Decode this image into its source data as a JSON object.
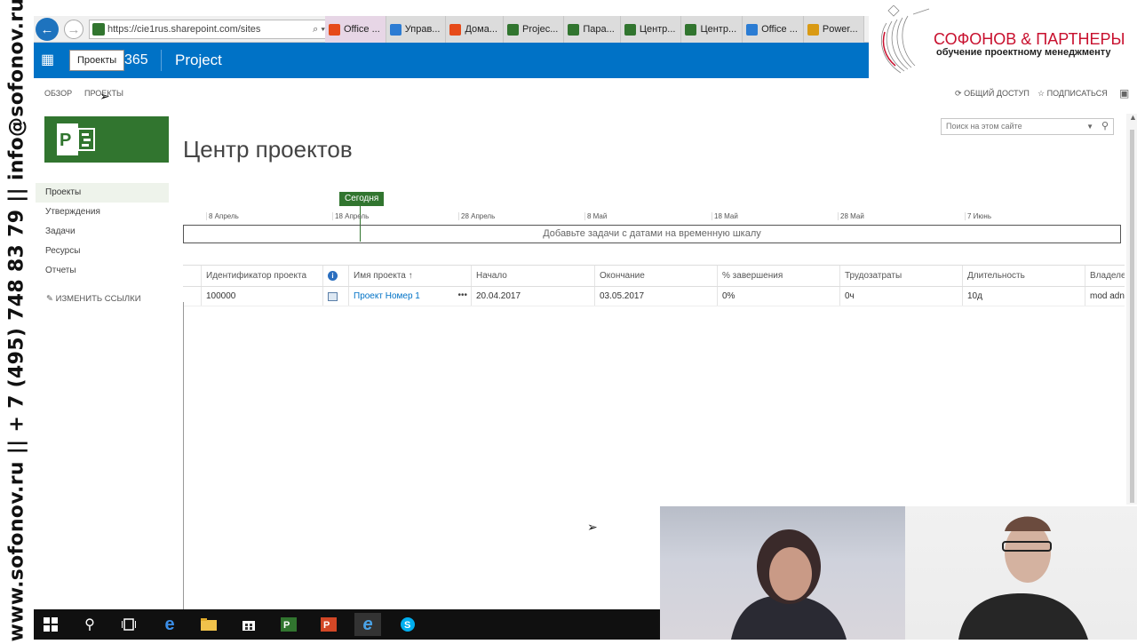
{
  "side_banner": "www.sofonov.ru || + 7 (495) 748 83 79 || info@sofonov.ru",
  "browser": {
    "url": "https://cie1rus.sharepoint.com/sites",
    "url_icons": "⌕ ▾ 🔒 ↻",
    "tabs": [
      {
        "label": "Office ...",
        "color": "#e64a19"
      },
      {
        "label": "Управ...",
        "color": "#2b7cd3"
      },
      {
        "label": "Дома...",
        "color": "#e64a19"
      },
      {
        "label": "Projec...",
        "color": "#31752f"
      },
      {
        "label": "Пара...",
        "color": "#31752f"
      },
      {
        "label": "Центр...",
        "color": "#31752f"
      },
      {
        "label": "Центр...",
        "color": "#31752f"
      },
      {
        "label": "Office ...",
        "color": "#2b7cd3"
      },
      {
        "label": "Power...",
        "color": "#d99a14"
      }
    ]
  },
  "o365": {
    "brand_partial": "365",
    "app": "Project"
  },
  "tooltip": "Проекты",
  "logo": {
    "name": "СОФОНОВ & ПАРТНЕРЫ",
    "tagline": "обучение проектному менеджменту"
  },
  "suite": {
    "tabs": [
      "ОБЗОР",
      "ПРОЕКТЫ"
    ],
    "share": "ОБЩИЙ ДОСТУП",
    "follow": "ПОДПИСАТЬСЯ"
  },
  "search_placeholder": "Поиск на этом сайте",
  "page_title": "Центр проектов",
  "left_nav": [
    "Проекты",
    "Утверждения",
    "Задачи",
    "Ресурсы",
    "Отчеты"
  ],
  "edit_links": "ИЗМЕНИТЬ ССЫЛКИ",
  "timeline": {
    "today": "Сегодня",
    "ticks": [
      "8 Апрель",
      "18 Апрель",
      "28 Апрель",
      "8 Май",
      "18 Май",
      "28 Май",
      "7 Июнь"
    ],
    "placeholder": "Добавьте задачи с датами на временную шкалу"
  },
  "grid": {
    "headers": [
      "Идентификатор проекта",
      "Имя проекта ↑",
      "Начало",
      "Окончание",
      "% завершения",
      "Трудозатраты",
      "Длительность",
      "Владеле"
    ],
    "rows": [
      {
        "id": "100000",
        "name": "Проект Номер 1",
        "start": "20.04.2017",
        "finish": "03.05.2017",
        "complete": "0%",
        "work": "0ч",
        "duration": "10д",
        "owner": "mod adn"
      }
    ]
  },
  "colors": {
    "suite_blue": "#0072c6",
    "project_green": "#31752f",
    "brand_red": "#c8102e"
  }
}
